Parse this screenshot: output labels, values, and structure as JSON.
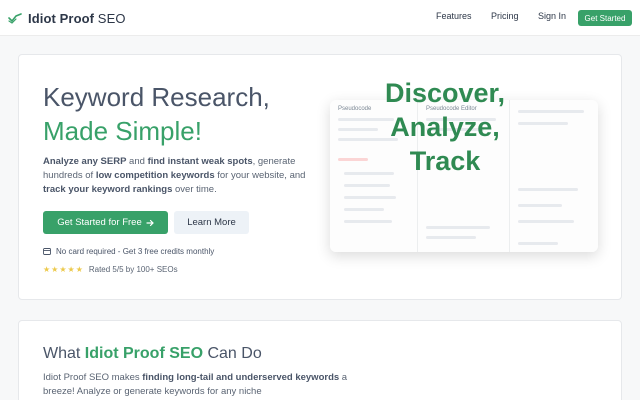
{
  "nav": {
    "brand_bold": "Idiot Proof",
    "brand_light": " SEO",
    "links": [
      "Features",
      "Pricing",
      "Sign In"
    ],
    "cta": "Get Started"
  },
  "hero": {
    "title_line1": "Keyword Research,",
    "title_line2": "Made Simple!",
    "desc": {
      "p1": "Analyze any SERP",
      "p2": " and ",
      "p3": "find instant weak spots",
      "p4": ", generate hundreds of ",
      "p5": "low competition keywords",
      "p6": " for your website, and ",
      "p7": "track your keyword rankings",
      "p8": " over time."
    },
    "primary_button": "Get Started for Free",
    "secondary_button": "Learn More",
    "note": "No card required - Get 3 free credits monthly",
    "rating": "Rated 5/5 by 100+ SEOs",
    "overlay_lines": [
      "Discover,",
      "Analyze,",
      "Track"
    ],
    "screenshot": {
      "pane1_title": "Pseudocode",
      "pane2_title": "Pseudocode Editor"
    }
  },
  "features": {
    "title_prefix": "What ",
    "title_brand": "Idiot Proof SEO",
    "title_suffix": " Can Do",
    "desc": {
      "p1": "Idiot Proof SEO makes ",
      "p2": "finding long-tail and underserved keywords",
      "p3": " a breeze! Analyze or generate keywords for any niche"
    }
  },
  "colors": {
    "accent": "#38a169",
    "text": "#4a5568",
    "star": "#ecc94b"
  },
  "icons": {
    "logo": "check-trend-icon",
    "arrow": "arrow-right-icon",
    "card": "credit-card-icon",
    "star": "star-icon"
  }
}
